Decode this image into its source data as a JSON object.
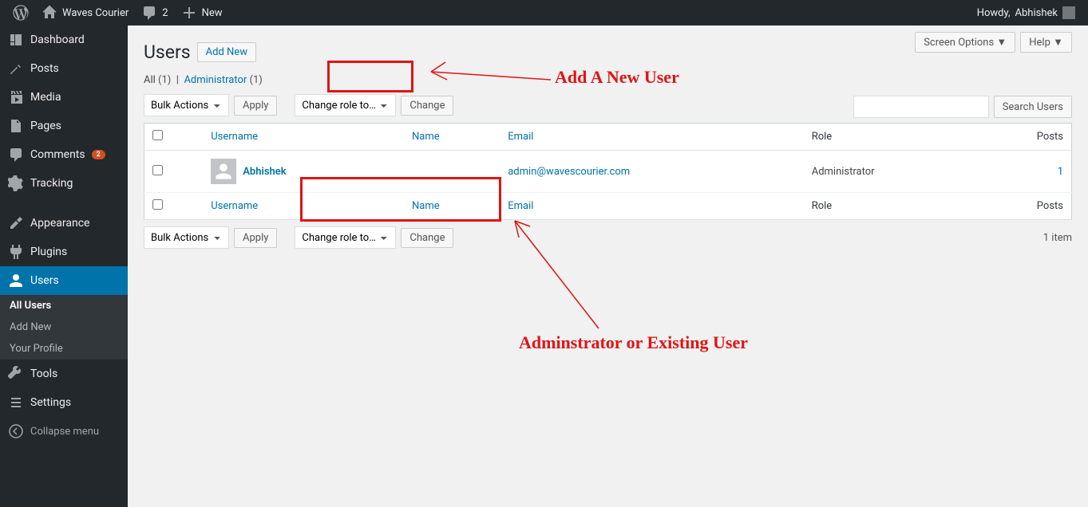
{
  "adminbar": {
    "site": "Waves Courier",
    "comments": "2",
    "new": "New",
    "howdy_prefix": "Howdy, ",
    "howdy_name": "Abhishek"
  },
  "sidebar": {
    "items": [
      {
        "label": "Dashboard"
      },
      {
        "label": "Posts"
      },
      {
        "label": "Media"
      },
      {
        "label": "Pages"
      },
      {
        "label": "Comments",
        "badge": "2"
      },
      {
        "label": "Tracking"
      },
      {
        "label": "Appearance"
      },
      {
        "label": "Plugins"
      },
      {
        "label": "Users"
      },
      {
        "label": "Tools"
      },
      {
        "label": "Settings"
      }
    ],
    "submenu": [
      {
        "label": "All Users",
        "current": true
      },
      {
        "label": "Add New"
      },
      {
        "label": "Your Profile"
      }
    ],
    "collapse": "Collapse menu"
  },
  "main": {
    "screen_options": "Screen Options",
    "help": "Help",
    "heading": "Users",
    "add_new": "Add New",
    "filters": {
      "all": "All",
      "all_count": "(1)",
      "sep": "|",
      "admin": "Administrator",
      "admin_count": "(1)"
    },
    "search_btn": "Search Users",
    "bulk": "Bulk Actions",
    "apply": "Apply",
    "role_change": "Change role to…",
    "change": "Change",
    "item_count": "1 item",
    "columns": {
      "username": "Username",
      "name": "Name",
      "email": "Email",
      "role": "Role",
      "posts": "Posts"
    },
    "rows": [
      {
        "username": "Abhishek",
        "name": "",
        "email": "admin@wavescourier.com",
        "role": "Administrator",
        "posts": "1"
      }
    ]
  },
  "annotations": {
    "a1": "Add A New User",
    "a2": "Adminstrator or Existing User"
  }
}
